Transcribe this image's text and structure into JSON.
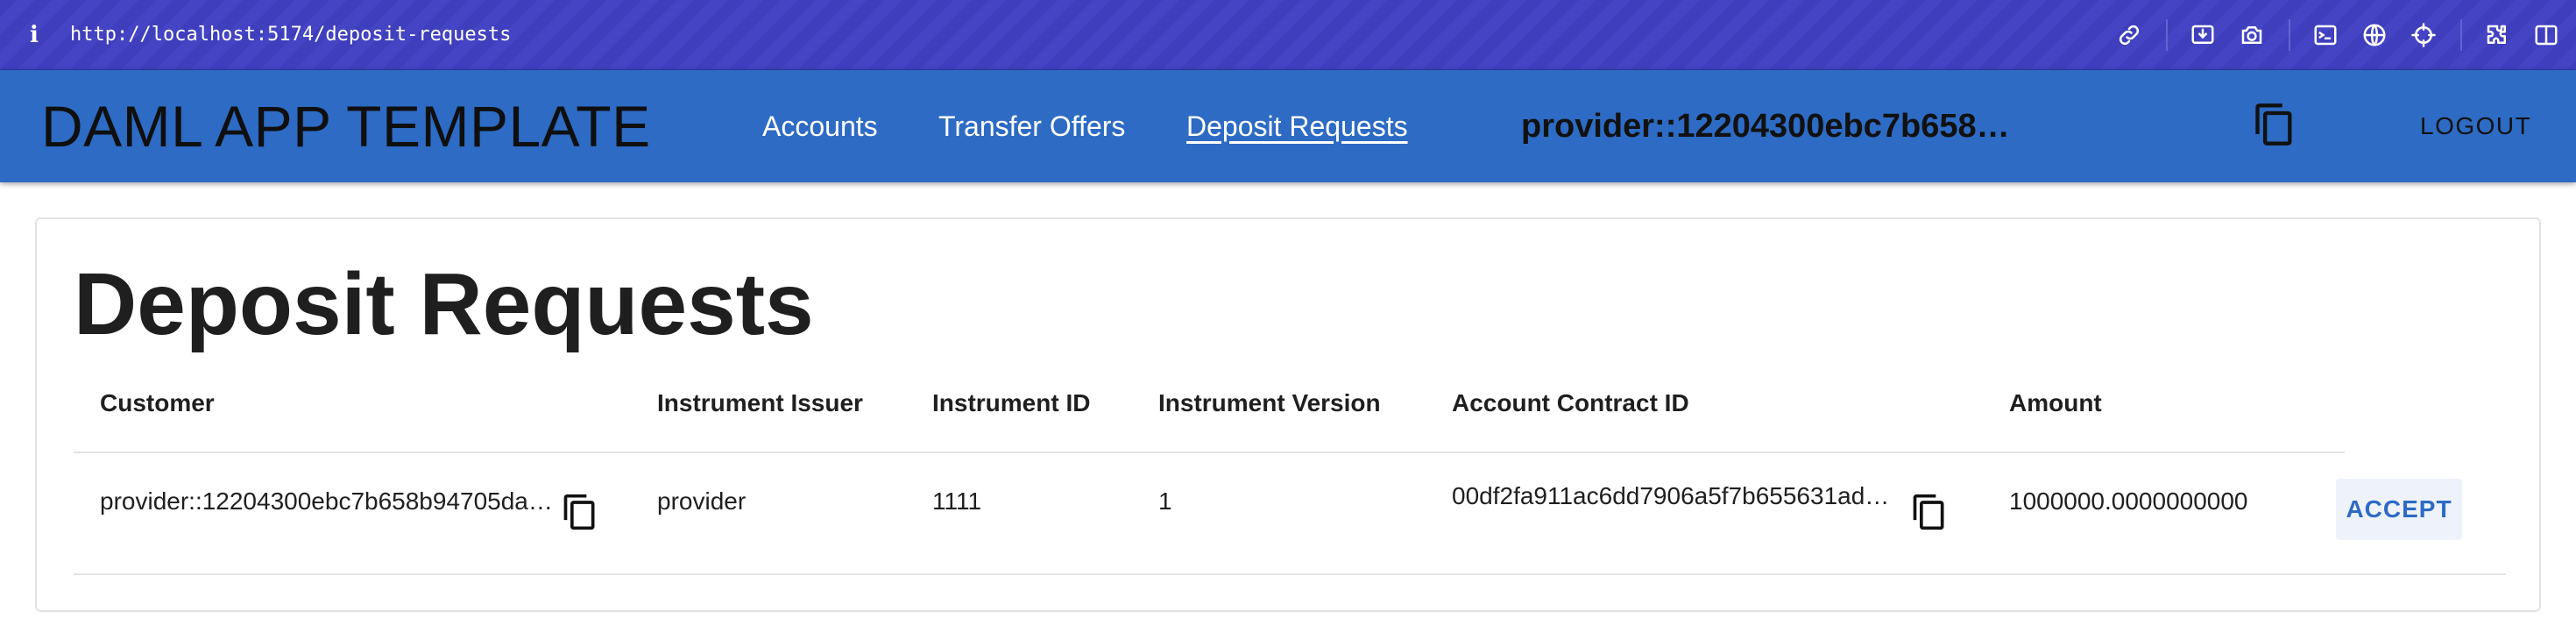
{
  "browser": {
    "info_glyph": "i",
    "url": "http://localhost:5174/deposit-requests",
    "icons": [
      "link-icon",
      "download-icon",
      "camera-icon",
      "terminal-icon",
      "globe-icon",
      "crosshair-icon",
      "extensions-icon",
      "sidebar-icon"
    ]
  },
  "appbar": {
    "title": "DAML APP TEMPLATE",
    "nav": {
      "accounts": "Accounts",
      "transfer_offers": "Transfer Offers",
      "deposit_requests": "Deposit Requests"
    },
    "active_nav": "Deposit Requests",
    "party": "provider::12204300ebc7b658b94705daea8…",
    "logout": "LOGOUT",
    "background_color": "#2d6bc4"
  },
  "page": {
    "title": "Deposit Requests",
    "table": {
      "headers": {
        "customer": "Customer",
        "instrument_issuer": "Instrument Issuer",
        "instrument_id": "Instrument ID",
        "instrument_version": "Instrument Version",
        "account_contract_id": "Account Contract ID",
        "amount": "Amount"
      },
      "rows": [
        {
          "customer": "provider::12204300ebc7b658b94705da…",
          "instrument_issuer": "provider",
          "instrument_id": "1111",
          "instrument_version": "1",
          "account_contract_id": "00df2fa911ac6dd7906a5f7b655631ad…",
          "amount": "1000000.0000000000",
          "action": "ACCEPT"
        }
      ]
    }
  }
}
